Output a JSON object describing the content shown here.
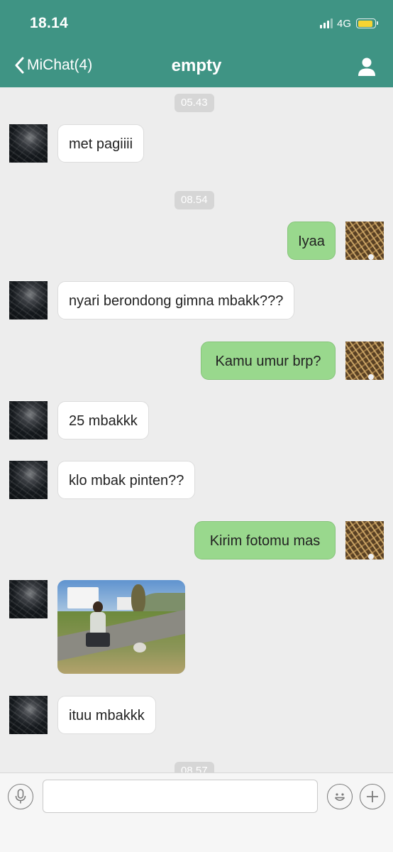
{
  "status_bar": {
    "time": "18.14",
    "network": "4G"
  },
  "header": {
    "back_label": "MiChat(4)",
    "title": "empty"
  },
  "chat": {
    "timestamps": [
      "05.43",
      "08.54",
      "08.57"
    ],
    "messages": [
      {
        "from": "other",
        "text": "met pagiiii"
      },
      {
        "from": "me",
        "text": "Iyaa"
      },
      {
        "from": "other",
        "text": "nyari berondong gimna mbakk???"
      },
      {
        "from": "me",
        "text": "Kamu umur brp?"
      },
      {
        "from": "other",
        "text": "25 mbakkk"
      },
      {
        "from": "other",
        "text": "klo mbak pinten??"
      },
      {
        "from": "me",
        "text": "Kirim fotomu mas"
      },
      {
        "from": "other",
        "type": "image"
      },
      {
        "from": "other",
        "text": "ituu mbakkk"
      }
    ]
  },
  "input_bar": {
    "placeholder": "",
    "icons": [
      "microphone-icon",
      "emoji-icon",
      "plus-icon"
    ]
  },
  "colors": {
    "header": "#3f9484",
    "outgoing_bubble": "#99d88d",
    "incoming_bubble": "#ffffff",
    "background": "#ededed",
    "battery": "#f6d433"
  }
}
